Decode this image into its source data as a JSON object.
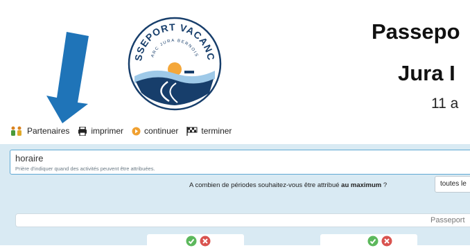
{
  "header": {
    "logo": {
      "top_text": "PASSEPORT VACANCES",
      "inner_text": "ARC JURA BERNOIS",
      "colors": {
        "navy": "#173e6b",
        "sun": "#f4a73a",
        "sky": "#9ec9e8"
      }
    },
    "title_line1": "Passepo",
    "title_line2": "Jura I",
    "date_text": "11 a"
  },
  "toolbar": {
    "partners_label": "Partenaires",
    "print_label": "imprimer",
    "continue_label": "continuer",
    "finish_label": "terminer"
  },
  "form": {
    "horaire_value": "horaire",
    "horaire_hint": "Prière d'indiquer quand des activités peuvent être attribuées.",
    "question_prefix": "A combien de périodes souhaitez-vous être attribué ",
    "question_bold": "au maximum",
    "question_suffix": " ?",
    "periods_selected": "toutes le"
  },
  "banner_text": "Passeport",
  "colors": {
    "arrow": "#1f74b8",
    "panel_bg": "#d9eaf3",
    "accept": "#5cb85c",
    "reject": "#d9534f",
    "continue": "#f0a030"
  },
  "icons": [
    "down-arrow-icon",
    "partners-icon",
    "printer-icon",
    "continue-icon",
    "finish-flag-icon",
    "check-icon",
    "x-icon"
  ]
}
